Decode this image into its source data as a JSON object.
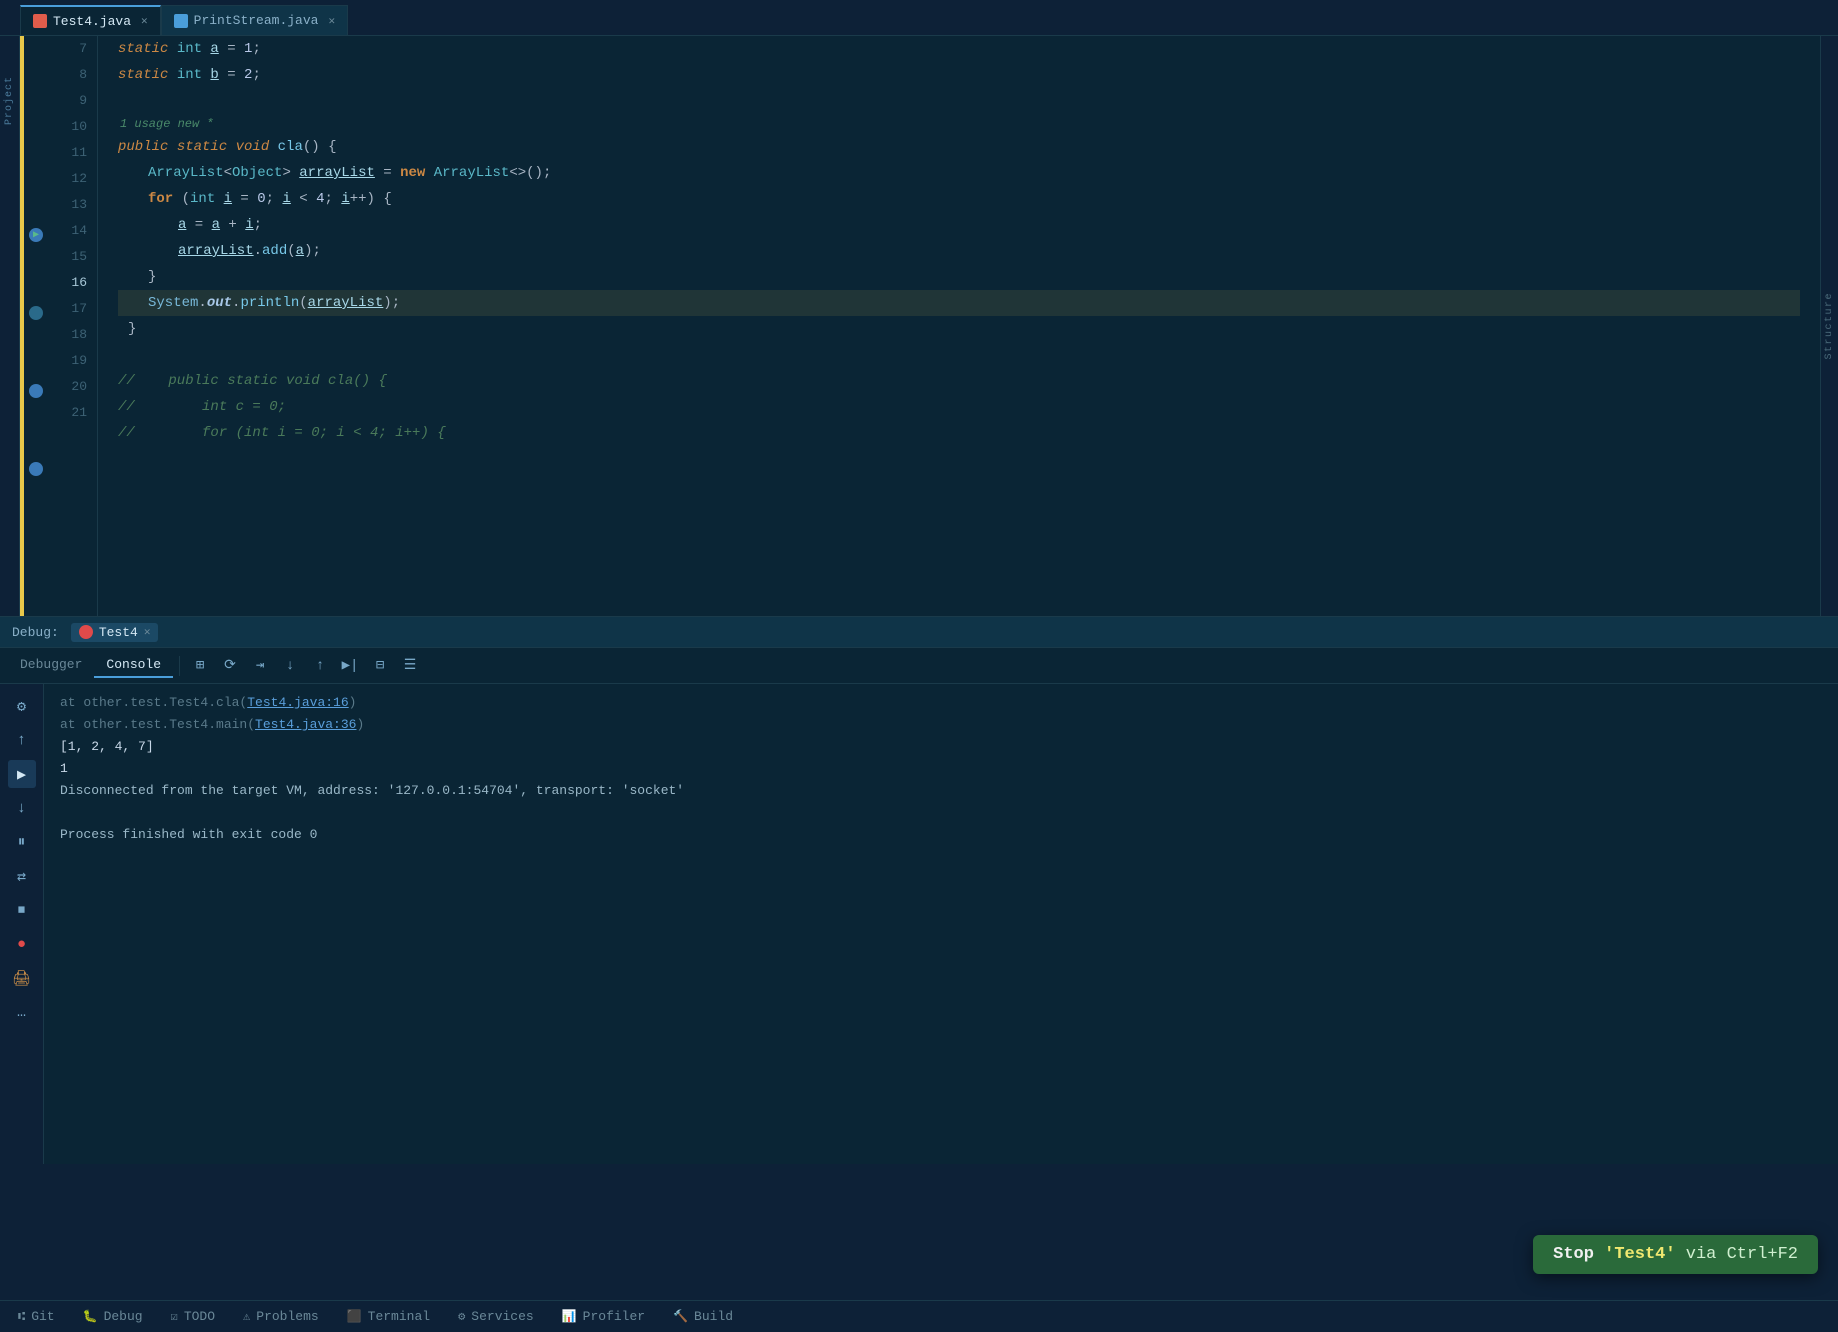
{
  "tabs": [
    {
      "label": "Test4.java",
      "type": "java",
      "active": true
    },
    {
      "label": "PrintStream.java",
      "type": "stream",
      "active": false
    }
  ],
  "editor": {
    "lines": [
      {
        "num": 7,
        "content": "static_int_a_=_1;",
        "type": "static_int"
      },
      {
        "num": 8,
        "content": "static_int_b_=_2;",
        "type": "static_int"
      },
      {
        "num": 9,
        "content": "",
        "type": "empty"
      },
      {
        "num": 10,
        "content": "public_static_void_cla()",
        "type": "method_decl"
      },
      {
        "num": 11,
        "content": "ArrayList<Object>_arrayList_=_new_ArrayList<>();",
        "type": "arraylist"
      },
      {
        "num": 12,
        "content": "for_(int_i_=_0;_i_<_4;_i++)_{",
        "type": "for"
      },
      {
        "num": 13,
        "content": "a_=_a_+_i;",
        "type": "assign"
      },
      {
        "num": 14,
        "content": "arrayList.add(a);",
        "type": "method_call"
      },
      {
        "num": 15,
        "content": "}",
        "type": "brace"
      },
      {
        "num": 16,
        "content": "System.out.println(arrayList);",
        "type": "println"
      },
      {
        "num": 17,
        "content": "}",
        "type": "brace"
      },
      {
        "num": 18,
        "content": "",
        "type": "empty"
      },
      {
        "num": 19,
        "content": "//    public static void cla() {",
        "type": "comment"
      },
      {
        "num": 20,
        "content": "//        int c = 0;",
        "type": "comment"
      },
      {
        "num": 21,
        "content": "//        for (int i = 0; i < 4; i++) {",
        "type": "comment"
      }
    ],
    "usage_hint": "1 usage   new *"
  },
  "debug": {
    "session_tab": "Test4",
    "tabs": [
      "Debugger",
      "Console"
    ],
    "active_tab": "Console",
    "toolbar": {
      "buttons": [
        "settings",
        "restore",
        "step-over",
        "step-into",
        "step-out",
        "run-to-cursor",
        "evaluate",
        "mute-breakpoints"
      ]
    }
  },
  "console": {
    "lines": [
      {
        "text": "at other.test.Test4.cla(Test4.java:16)",
        "type": "link",
        "link": "Test4.java:16"
      },
      {
        "text": "at other.test.Test4.main(Test4.java:36)",
        "type": "link",
        "link": "Test4.java:36"
      },
      {
        "text": "[1, 2, 4, 7]",
        "type": "output"
      },
      {
        "text": "1",
        "type": "output"
      },
      {
        "text": "Disconnected from the target VM, address: '127.0.0.1:54704', transport: 'socket'",
        "type": "normal"
      },
      {
        "text": "",
        "type": "empty"
      },
      {
        "text": "Process finished with exit code 0",
        "type": "normal"
      }
    ]
  },
  "status_bar": {
    "items": [
      {
        "icon": "git",
        "label": "Git"
      },
      {
        "icon": "bug",
        "label": "Debug"
      },
      {
        "icon": "todo",
        "label": "TODO"
      },
      {
        "icon": "problems",
        "label": "Problems"
      },
      {
        "icon": "terminal",
        "label": "Terminal"
      },
      {
        "icon": "services",
        "label": "Services"
      },
      {
        "icon": "profiler",
        "label": "Profiler"
      },
      {
        "icon": "build",
        "label": "Build"
      }
    ]
  },
  "tooltip": {
    "prefix": "Stop ",
    "name": "'Test4'",
    "suffix": " via Ctrl+F2"
  }
}
